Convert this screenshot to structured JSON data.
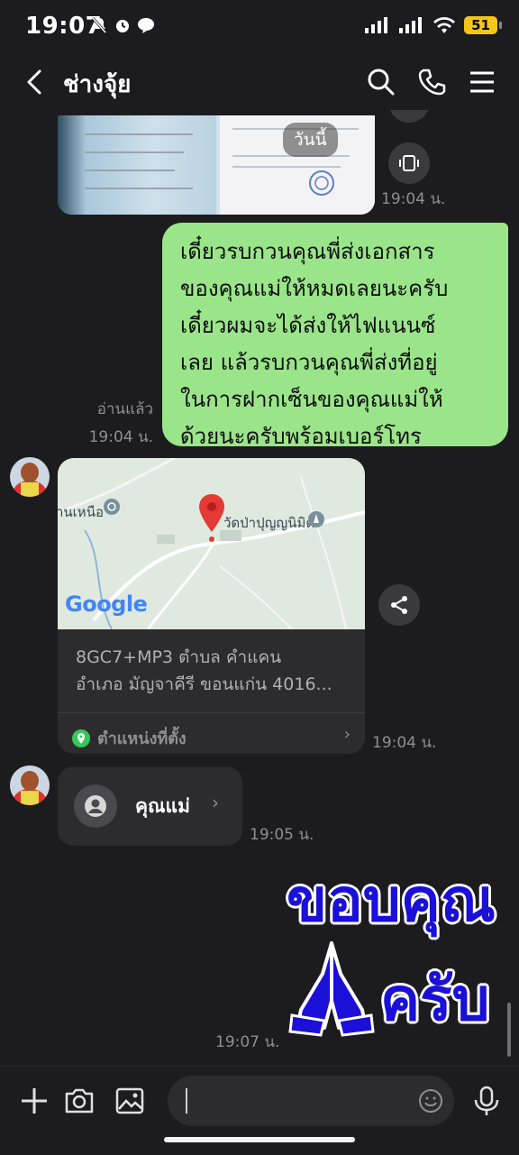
{
  "status": {
    "time": "19:07",
    "battery": "51"
  },
  "header": {
    "title": "ช่างจุ้ย"
  },
  "messages": {
    "image_date_chip": "วันนี้",
    "image_time": "19:04 น.",
    "outgoing": {
      "lines": [
        "เดี๋ยวรบกวนคุณพี่ส่งเอกสาร",
        "ของคุณแม่ให้หมดเลยนะครับ",
        "เดี๋ยวผมจะได้ส่งให้ไฟแนนซ์",
        "เลย  แล้วรบกวนคุณพี่ส่งที่อยู่",
        "ในการฝากเซ็นของคุณแม่ให้",
        "ด้วยนะครับพร้อมเบอร์โทร"
      ],
      "read_label": "อ่านแล้ว",
      "time": "19:04 น."
    },
    "location": {
      "map_label_left": "านเหนือ",
      "map_label_temple": "วัดป่าปุญญนิมิต",
      "map_brand": "Google",
      "address_line1": "8GC7+MP3 ตำบล คำแคน",
      "address_line2": "อำเภอ มัญจาคีรี ขอนแก่น 4016...",
      "footer_label": "ตำแหน่งที่ตั้ง",
      "time": "19:04 น."
    },
    "contact": {
      "name": "คุณแม่",
      "time": "19:05 น."
    },
    "sticker": {
      "line1": "ขอบคุณ",
      "line2": "ครับ",
      "time": "19:07 น."
    }
  },
  "colors": {
    "outgoing_bubble": "#9ae58a",
    "background": "#1c1c1e",
    "sticker_blue": "#1a10d8",
    "pin_red": "#e53935"
  },
  "icons": [
    "back-arrow-icon",
    "search-icon",
    "phone-icon",
    "menu-icon",
    "screenshot-icon",
    "share-icon",
    "location-pin-icon",
    "person-icon",
    "plus-icon",
    "camera-icon",
    "gallery-icon",
    "emoji-icon",
    "mic-icon"
  ]
}
